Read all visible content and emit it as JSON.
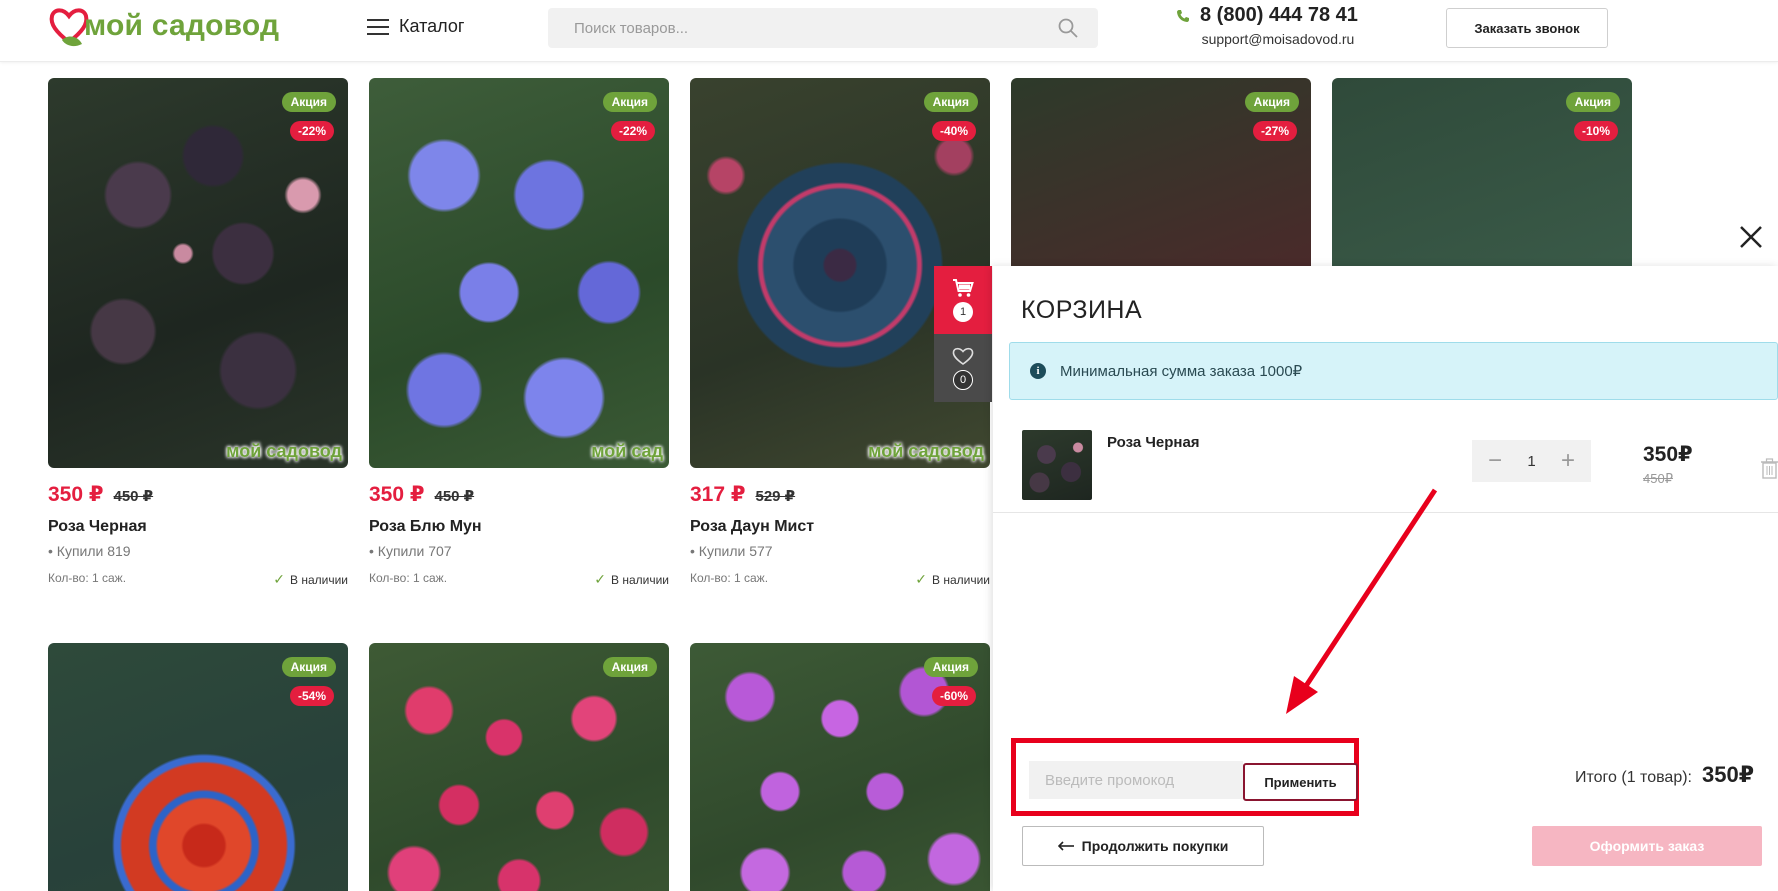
{
  "header": {
    "logo_text": "мой садовод",
    "catalog_label": "Каталог",
    "search_placeholder": "Поиск товаров...",
    "phone": "8 (800) 444 78 41",
    "email": "support@moisadovod.ru",
    "callback_label": "Заказать звонок"
  },
  "products": [
    {
      "badge": "Акция",
      "discount": "-22%",
      "price": "350 ₽",
      "old_price": "450 ₽",
      "name": "Роза Черная",
      "sold": "• Купили 819",
      "qty": "Кол-во: 1 саж.",
      "stock": "В наличии",
      "watermark": "мой садовод"
    },
    {
      "badge": "Акция",
      "discount": "-22%",
      "price": "350 ₽",
      "old_price": "450 ₽",
      "name": "Роза Блю Мун",
      "sold": "• Купили 707",
      "qty": "Кол-во: 1 саж.",
      "stock": "В наличии",
      "watermark": "мой сад"
    },
    {
      "badge": "Акция",
      "discount": "-40%",
      "price": "317 ₽",
      "old_price": "529 ₽",
      "name": "Роза Даун Мист",
      "sold": "• Купили 577",
      "qty": "Кол-во: 1 саж.",
      "stock": "В наличии",
      "watermark": "мой садовод"
    },
    {
      "badge": "Акция",
      "discount": "-27%"
    },
    {
      "badge": "Акция",
      "discount": "-10%"
    },
    {
      "badge": "Акция",
      "discount": "-54%"
    },
    {
      "badge": "Акция",
      "discount": ""
    },
    {
      "badge": "Акция",
      "discount": "-60%"
    }
  ],
  "floating": {
    "cart_count": "1",
    "fav_count": "0"
  },
  "cart": {
    "title": "КОРЗИНА",
    "notice": "Минимальная сумма заказа 1000₽",
    "item": {
      "name": "Роза Черная",
      "qty": "1",
      "price": "350₽",
      "old_price": "450₽"
    },
    "promo_placeholder": "Введите промокод",
    "apply_label": "Применить",
    "total_label": "Итого (1 товар):",
    "total_value": "350₽",
    "continue_label": "Продолжить покупки",
    "order_label": "Оформить заказ"
  },
  "colors": {
    "brand_green": "#6fa33b",
    "accent_red": "#e41e3f",
    "info_bg": "#d6f3f9",
    "annotation_red": "#e8001c"
  }
}
